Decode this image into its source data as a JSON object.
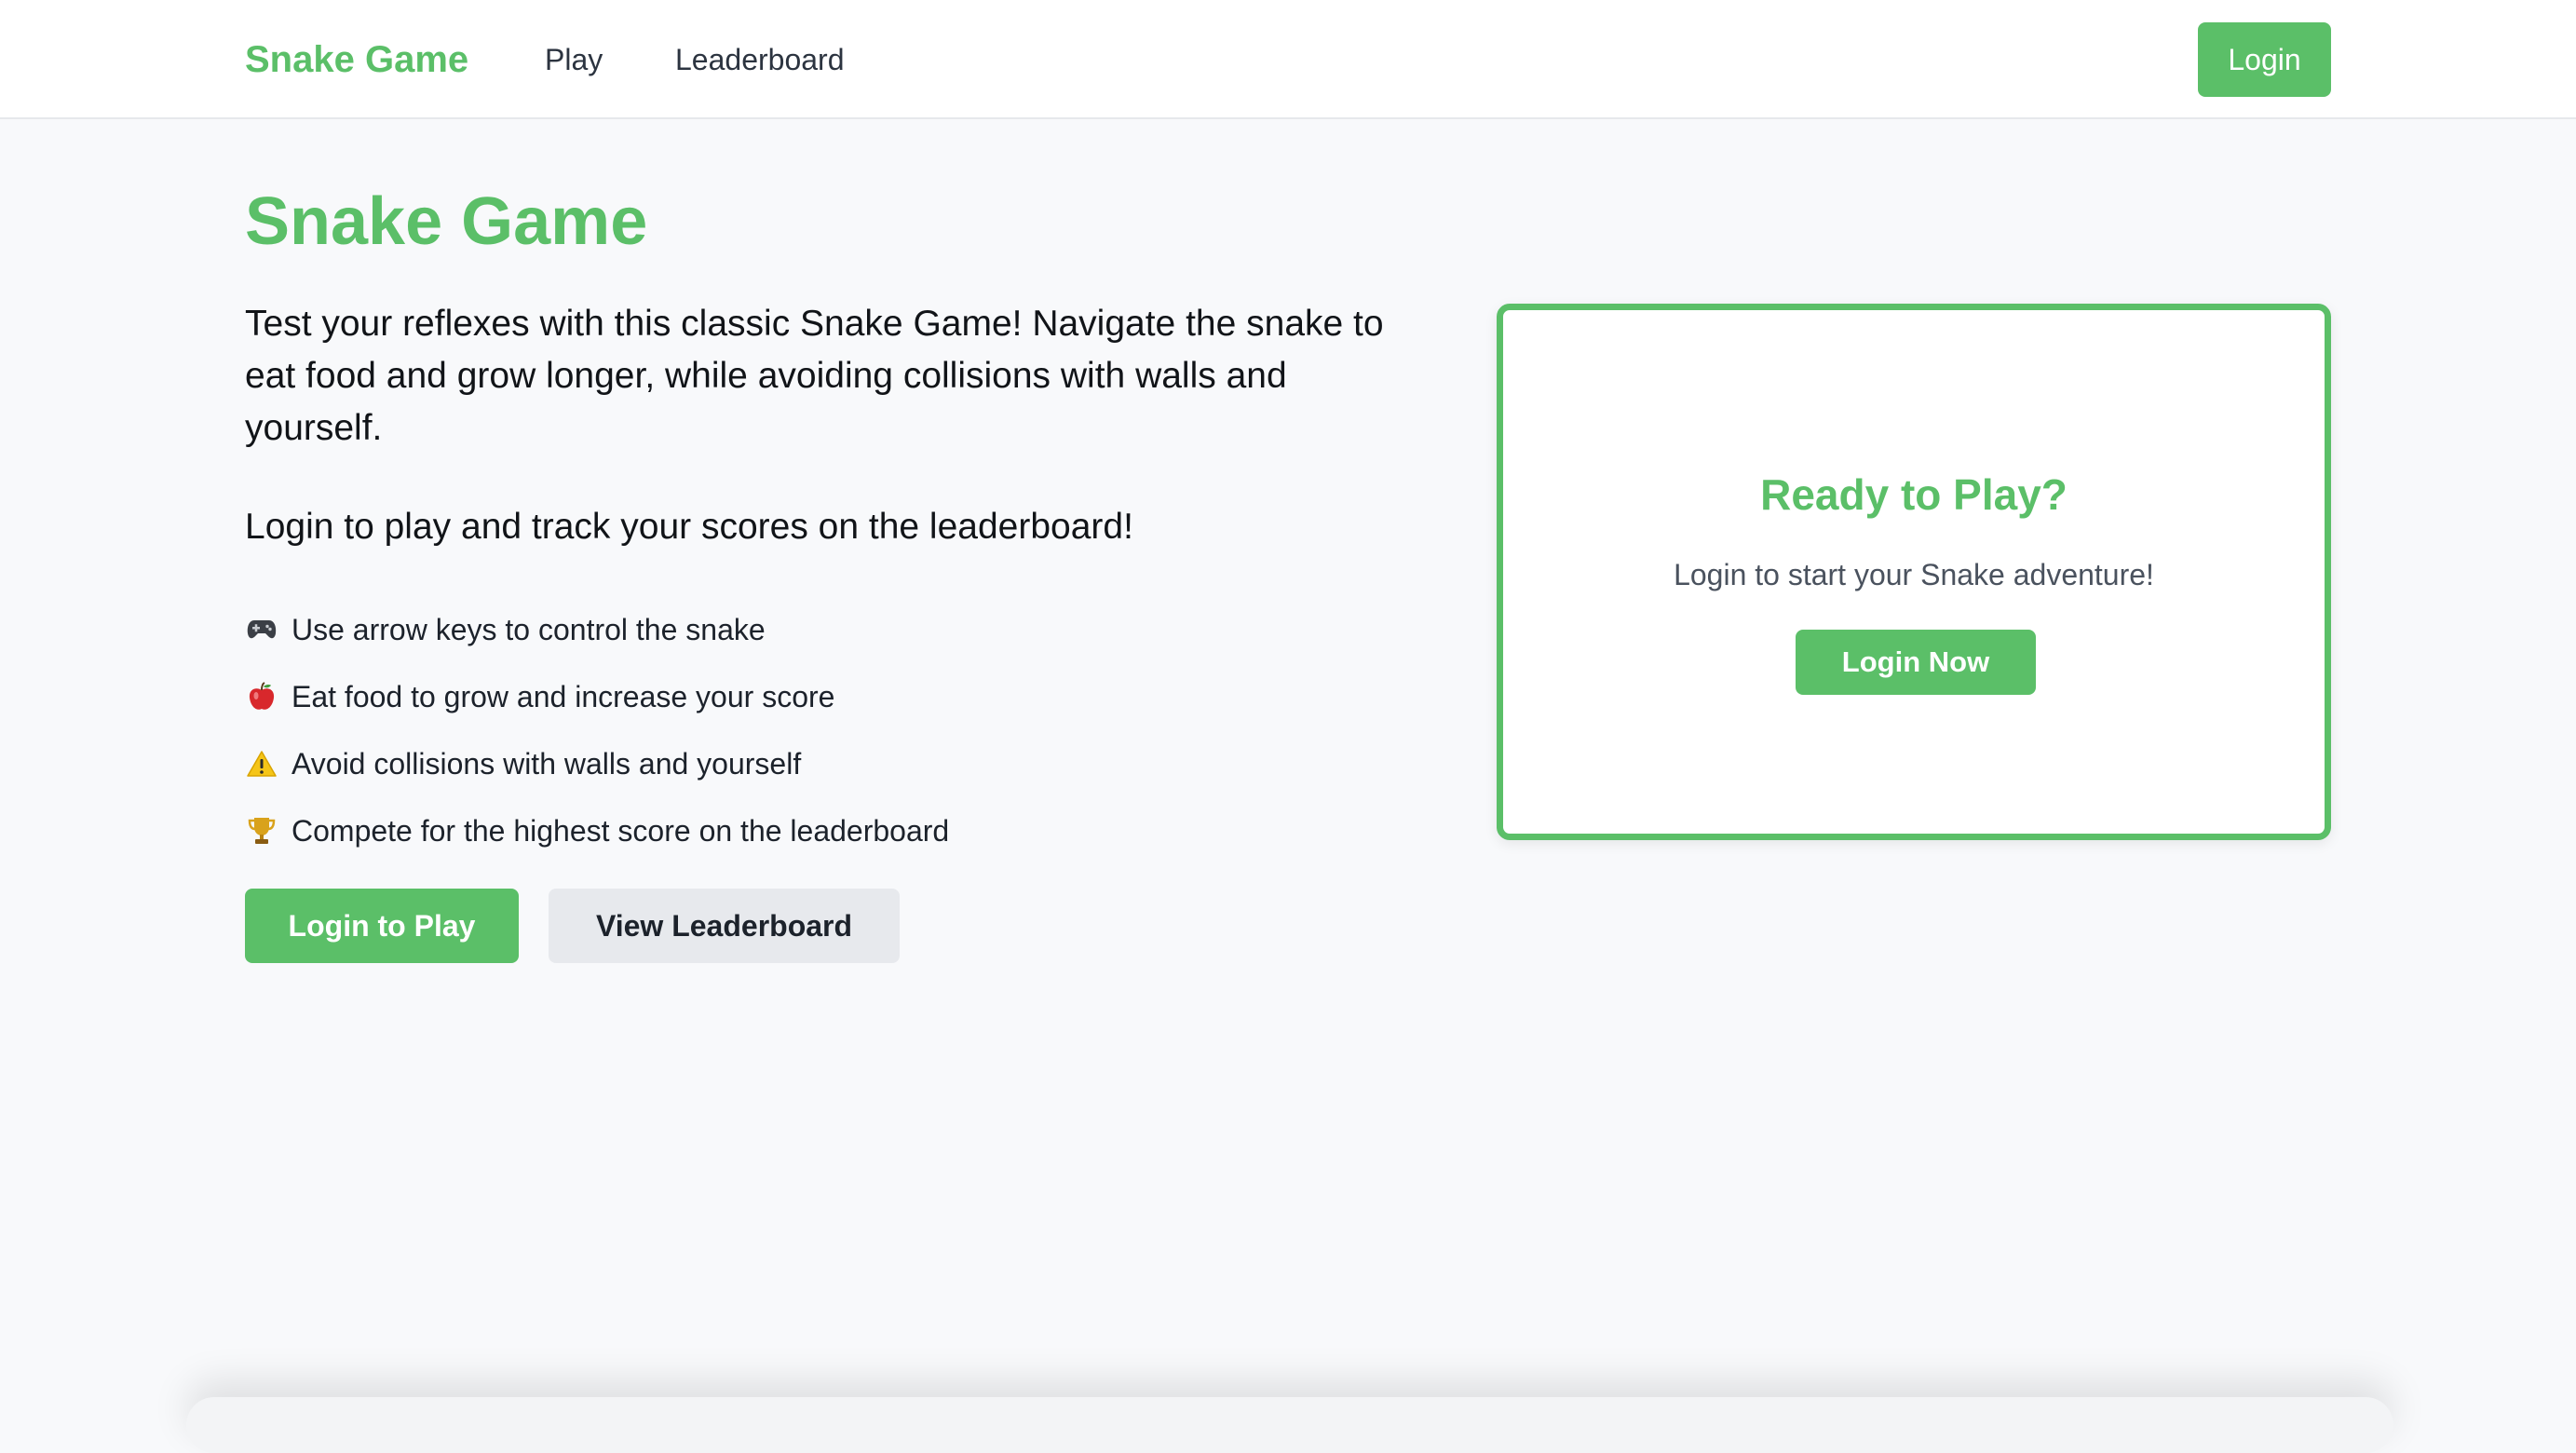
{
  "nav": {
    "brand": "Snake Game",
    "links": [
      "Play",
      "Leaderboard"
    ],
    "login_label": "Login"
  },
  "main": {
    "title": "Snake Game",
    "intro": "Test your reflexes with this classic Snake Game! Navigate the snake to eat food and grow longer, while avoiding collisions with walls and yourself.",
    "login_prompt": "Login to play and track your scores on the leaderboard!",
    "features": [
      {
        "icon": "gamepad-icon",
        "text": "Use arrow keys to control the snake"
      },
      {
        "icon": "apple-icon",
        "text": "Eat food to grow and increase your score"
      },
      {
        "icon": "warning-icon",
        "text": "Avoid collisions with walls and yourself"
      },
      {
        "icon": "trophy-icon",
        "text": "Compete for the highest score on the leaderboard"
      }
    ],
    "primary_button": "Login to Play",
    "secondary_button": "View Leaderboard"
  },
  "card": {
    "title": "Ready to Play?",
    "subtitle": "Login to start your Snake adventure!",
    "button": "Login Now"
  },
  "colors": {
    "accent": "#5bbf68",
    "background": "#f8f9fb",
    "secondary_button": "#e7e9ed"
  }
}
